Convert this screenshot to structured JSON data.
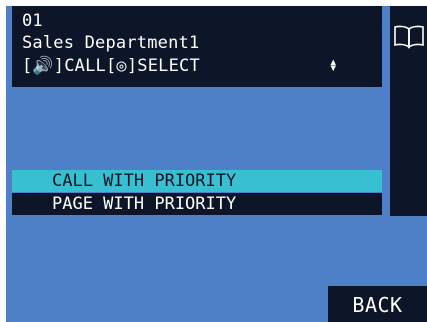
{
  "header": {
    "line1": "01",
    "line2": "Sales Department1",
    "line3": "[🔊]CALL[◎]SELECT"
  },
  "icons": {
    "scroll": "up-down-arrows-icon",
    "book": "book-icon"
  },
  "menu": {
    "items": [
      {
        "label": "CALL WITH PRIORITY",
        "selected": true
      },
      {
        "label": "PAGE WITH PRIORITY",
        "selected": false
      }
    ]
  },
  "footer": {
    "back_label": "BACK"
  },
  "colors": {
    "background": "#4d80c6",
    "panel": "#0c1628",
    "highlight": "#38bfd2",
    "text": "#ffffff"
  }
}
